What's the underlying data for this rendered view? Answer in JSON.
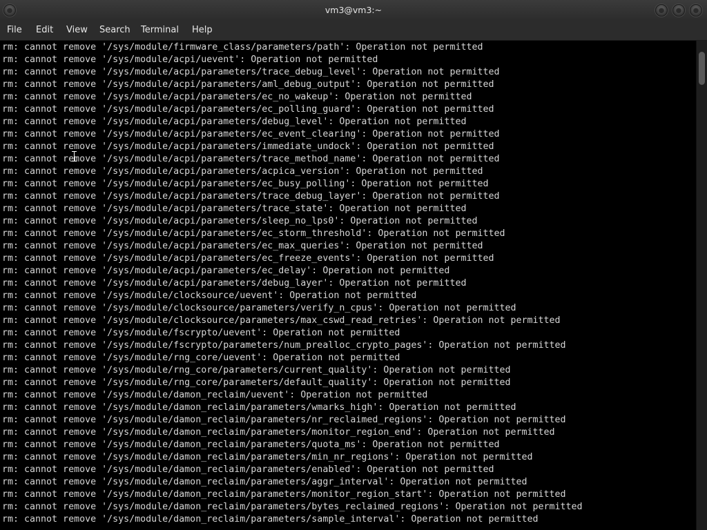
{
  "window": {
    "title": "vm3@vm3:~"
  },
  "menubar": {
    "items": [
      "File",
      "Edit",
      "View",
      "Search",
      "Terminal",
      "Help"
    ]
  },
  "terminal": {
    "lines": [
      "rm: cannot remove '/sys/module/firmware_class/parameters/path': Operation not permitted",
      "rm: cannot remove '/sys/module/acpi/uevent': Operation not permitted",
      "rm: cannot remove '/sys/module/acpi/parameters/trace_debug_level': Operation not permitted",
      "rm: cannot remove '/sys/module/acpi/parameters/aml_debug_output': Operation not permitted",
      "rm: cannot remove '/sys/module/acpi/parameters/ec_no_wakeup': Operation not permitted",
      "rm: cannot remove '/sys/module/acpi/parameters/ec_polling_guard': Operation not permitted",
      "rm: cannot remove '/sys/module/acpi/parameters/debug_level': Operation not permitted",
      "rm: cannot remove '/sys/module/acpi/parameters/ec_event_clearing': Operation not permitted",
      "rm: cannot remove '/sys/module/acpi/parameters/immediate_undock': Operation not permitted",
      "rm: cannot remove '/sys/module/acpi/parameters/trace_method_name': Operation not permitted",
      "rm: cannot remove '/sys/module/acpi/parameters/acpica_version': Operation not permitted",
      "rm: cannot remove '/sys/module/acpi/parameters/ec_busy_polling': Operation not permitted",
      "rm: cannot remove '/sys/module/acpi/parameters/trace_debug_layer': Operation not permitted",
      "rm: cannot remove '/sys/module/acpi/parameters/trace_state': Operation not permitted",
      "rm: cannot remove '/sys/module/acpi/parameters/sleep_no_lps0': Operation not permitted",
      "rm: cannot remove '/sys/module/acpi/parameters/ec_storm_threshold': Operation not permitted",
      "rm: cannot remove '/sys/module/acpi/parameters/ec_max_queries': Operation not permitted",
      "rm: cannot remove '/sys/module/acpi/parameters/ec_freeze_events': Operation not permitted",
      "rm: cannot remove '/sys/module/acpi/parameters/ec_delay': Operation not permitted",
      "rm: cannot remove '/sys/module/acpi/parameters/debug_layer': Operation not permitted",
      "rm: cannot remove '/sys/module/clocksource/uevent': Operation not permitted",
      "rm: cannot remove '/sys/module/clocksource/parameters/verify_n_cpus': Operation not permitted",
      "rm: cannot remove '/sys/module/clocksource/parameters/max_cswd_read_retries': Operation not permitted",
      "rm: cannot remove '/sys/module/fscrypto/uevent': Operation not permitted",
      "rm: cannot remove '/sys/module/fscrypto/parameters/num_prealloc_crypto_pages': Operation not permitted",
      "rm: cannot remove '/sys/module/rng_core/uevent': Operation not permitted",
      "rm: cannot remove '/sys/module/rng_core/parameters/current_quality': Operation not permitted",
      "rm: cannot remove '/sys/module/rng_core/parameters/default_quality': Operation not permitted",
      "rm: cannot remove '/sys/module/damon_reclaim/uevent': Operation not permitted",
      "rm: cannot remove '/sys/module/damon_reclaim/parameters/wmarks_high': Operation not permitted",
      "rm: cannot remove '/sys/module/damon_reclaim/parameters/nr_reclaimed_regions': Operation not permitted",
      "rm: cannot remove '/sys/module/damon_reclaim/parameters/monitor_region_end': Operation not permitted",
      "rm: cannot remove '/sys/module/damon_reclaim/parameters/quota_ms': Operation not permitted",
      "rm: cannot remove '/sys/module/damon_reclaim/parameters/min_nr_regions': Operation not permitted",
      "rm: cannot remove '/sys/module/damon_reclaim/parameters/enabled': Operation not permitted",
      "rm: cannot remove '/sys/module/damon_reclaim/parameters/aggr_interval': Operation not permitted",
      "rm: cannot remove '/sys/module/damon_reclaim/parameters/monitor_region_start': Operation not permitted",
      "rm: cannot remove '/sys/module/damon_reclaim/parameters/bytes_reclaimed_regions': Operation not permitted",
      "rm: cannot remove '/sys/module/damon_reclaim/parameters/sample_interval': Operation not permitted"
    ]
  }
}
